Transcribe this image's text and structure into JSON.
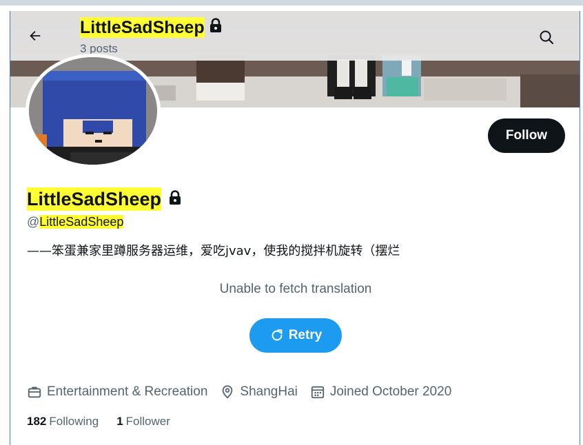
{
  "header": {
    "back_icon": "arrow-left-icon",
    "name": "LittleSadSheep",
    "posts": "3 posts",
    "search_icon": "search-icon"
  },
  "profile": {
    "display_name": "LittleSadSheep",
    "handle_prefix": "@",
    "handle": "LittleSadSheep",
    "bio": "——笨蛋兼家里蹲服务器运维，爱吃jvav，使我的搅拌机旋转（摆烂",
    "protected_icon": "lock-icon"
  },
  "actions": {
    "follow_label": "Follow"
  },
  "translation": {
    "message": "Unable to fetch translation",
    "retry_label": "Retry",
    "retry_icon": "refresh-icon"
  },
  "meta": {
    "category": "Entertainment & Recreation",
    "category_icon": "briefcase-icon",
    "location": "ShangHai",
    "location_icon": "location-pin-icon",
    "joined": "Joined October 2020",
    "joined_icon": "calendar-icon"
  },
  "stats": {
    "following_count": "182",
    "following_label": "Following",
    "followers_count": "1",
    "followers_label": "Follower"
  },
  "colors": {
    "accent": "#1d9bf0",
    "follow_bg": "#0f1419",
    "highlight": "#ffff33",
    "secondary_text": "#536471"
  }
}
